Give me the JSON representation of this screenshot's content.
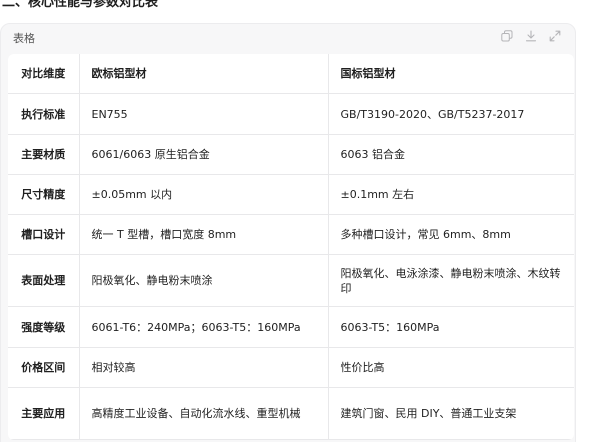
{
  "heading": "二、核心性能与参数对比表",
  "card": {
    "label": "表格",
    "tools": {
      "copy_icon": "copy-icon",
      "download_icon": "download-icon",
      "expand_icon": "expand-icon"
    }
  },
  "table": {
    "headers": [
      "对比维度",
      "欧标铝型材",
      "国标铝型材"
    ],
    "rows": [
      [
        "执行标准",
        "EN755",
        "GB/T3190-2020、GB/T5237-2017"
      ],
      [
        "主要材质",
        "6061/6063 原生铝合金",
        "6063 铝合金"
      ],
      [
        "尺寸精度",
        "±0.05mm 以内",
        "±0.1mm 左右"
      ],
      [
        "槽口设计",
        "统一 T 型槽，槽口宽度 8mm",
        "多种槽口设计，常见 6mm、8mm"
      ],
      [
        "表面处理",
        "阳极氧化、静电粉末喷涂",
        "阳极氧化、电泳涂漆、静电粉末喷涂、木纹转印"
      ],
      [
        "强度等级",
        "6061-T6：240MPa；6063-T5：160MPa",
        "6063-T5：160MPa"
      ],
      [
        "价格区间",
        "相对较高",
        "性价比高"
      ],
      [
        "主要应用",
        "高精度工业设备、自动化流水线、重型机械",
        "建筑门窗、民用 DIY、普通工业支架"
      ]
    ]
  },
  "colors": {
    "card_bg": "#f7f7f8",
    "table_bg": "#ffffff",
    "border": "#e8e8ea",
    "text": "#1f1f1f"
  }
}
